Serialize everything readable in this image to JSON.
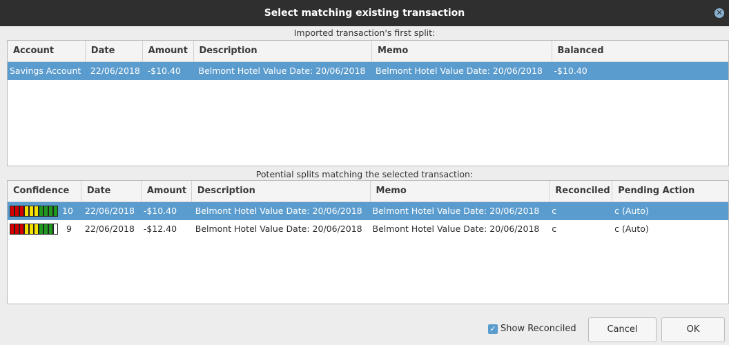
{
  "window": {
    "title": "Select matching existing transaction"
  },
  "imported": {
    "label": "Imported transaction's first split:",
    "columns": [
      "Account",
      "Date",
      "Amount",
      "Description",
      "Memo",
      "Balanced"
    ],
    "rows": [
      {
        "account": "Savings Account",
        "date": "22/06/2018",
        "amount": "-$10.40",
        "description": "Belmont Hotel Value Date: 20/06/2018",
        "memo": "Belmont Hotel Value Date: 20/06/2018",
        "balanced": "-$10.40"
      }
    ]
  },
  "potential": {
    "label": "Potential splits matching the selected transaction:",
    "columns": [
      "Confidence",
      "Date",
      "Amount",
      "Description",
      "Memo",
      "Reconciled",
      "Pending Action"
    ],
    "rows": [
      {
        "confidence": "10",
        "date": "22/06/2018",
        "amount": "-$10.40",
        "description": "Belmont Hotel Value Date: 20/06/2018",
        "memo": "Belmont Hotel Value Date: 20/06/2018",
        "reconciled": "c",
        "pending_action": "c (Auto)"
      },
      {
        "confidence": "9",
        "date": "22/06/2018",
        "amount": "-$12.40",
        "description": "Belmont Hotel Value Date: 20/06/2018",
        "memo": "Belmont Hotel Value Date: 20/06/2018",
        "reconciled": "c",
        "pending_action": "c (Auto)"
      }
    ],
    "confidence_colors": {
      "red": "#d40000",
      "yellow": "#f5e000",
      "green": "#1f9a1f"
    }
  },
  "footer": {
    "show_reconciled_label": "Show Reconciled",
    "show_reconciled_checked": true,
    "cancel_label": "Cancel",
    "ok_label": "OK"
  },
  "colors": {
    "selection": "#5b9cce",
    "titlebar": "#2f2f2f"
  },
  "icons": {
    "close": "close-icon",
    "checkbox": "check-icon"
  }
}
